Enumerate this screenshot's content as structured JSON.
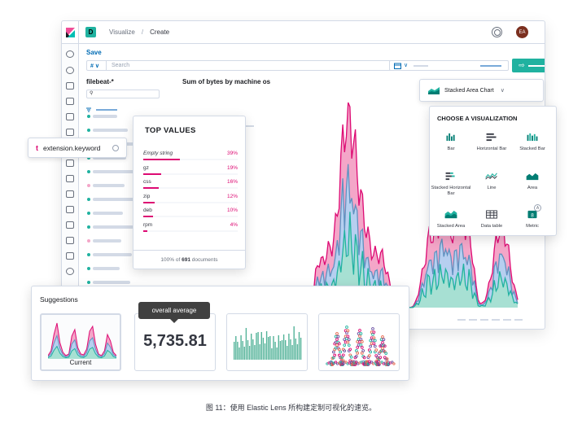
{
  "header": {
    "app_badge": "D",
    "breadcrumbs": [
      "Visualize",
      "Create"
    ],
    "breadcrumb_sep": "/",
    "avatar": "EA"
  },
  "toolbar": {
    "save_label": "Save"
  },
  "query": {
    "lang_label": "# ∨",
    "placeholder": "Search"
  },
  "datepicker": {
    "icon": "calendar-icon"
  },
  "sidebar": {
    "index_pattern": "filebeat-*"
  },
  "chart": {
    "title": "Sum of bytes by machine os"
  },
  "field_popover": {
    "type_icon": "t",
    "field_name": "extension.keyword"
  },
  "top_values": {
    "title": "TOP VALUES",
    "rows": [
      {
        "name": "Empty string",
        "pct": "39%",
        "frac": 0.39
      },
      {
        "name": "gz",
        "pct": "19%",
        "frac": 0.19
      },
      {
        "name": "css",
        "pct": "16%",
        "frac": 0.16
      },
      {
        "name": "zip",
        "pct": "12%",
        "frac": 0.12
      },
      {
        "name": "deb",
        "pct": "10%",
        "frac": 0.1
      },
      {
        "name": "rpm",
        "pct": "4%",
        "frac": 0.04
      }
    ],
    "footer_prefix": "100% of ",
    "footer_count": "691",
    "footer_suffix": " documents"
  },
  "viz_switcher": {
    "current": "Stacked Area Chart",
    "title": "CHOOSE A VISUALIZATION",
    "options": [
      {
        "label": "Bar",
        "icon": "bar-chart-icon"
      },
      {
        "label": "Horizontal Bar",
        "icon": "horizontal-bar-icon"
      },
      {
        "label": "Stacked Bar",
        "icon": "stacked-bar-icon"
      },
      {
        "label": "Stacked Horizontal Bar",
        "icon": "stacked-horizontal-bar-icon"
      },
      {
        "label": "Line",
        "icon": "line-chart-icon"
      },
      {
        "label": "Area",
        "icon": "area-chart-icon"
      },
      {
        "label": "Stacked Area",
        "icon": "stacked-area-icon"
      },
      {
        "label": "Data table",
        "icon": "table-icon"
      },
      {
        "label": "Metric",
        "icon": "metric-icon"
      }
    ]
  },
  "suggestions": {
    "title": "Suggestions",
    "current_label": "Current",
    "metric_value": "5,735.81",
    "tooltip": "overall average"
  },
  "caption": "图 11：使用 Elastic Lens 所构建定制可视化的速览。",
  "colors": {
    "pink": "#dd0a73",
    "pink_fill": "#f4a6c8",
    "blue": "#6092c0",
    "blue_fill": "#b6cff0",
    "teal": "#20b2a0",
    "teal_fill": "#a7e0d3"
  }
}
